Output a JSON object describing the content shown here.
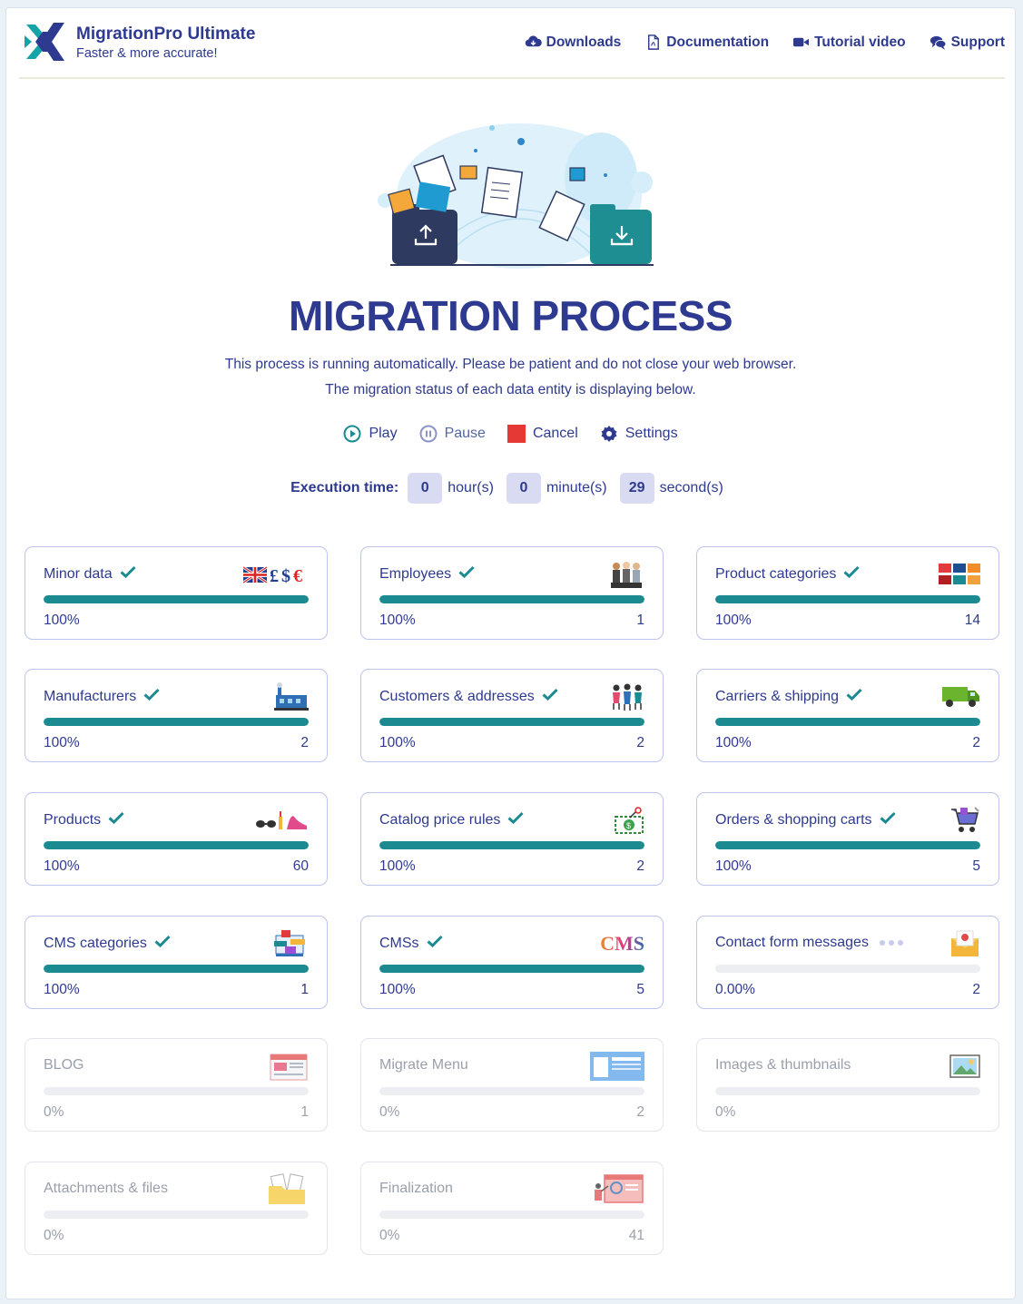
{
  "header": {
    "brand_title": "MigrationPro Ultimate",
    "brand_subtitle": "Faster & more accurate!",
    "nav": [
      {
        "label": "Downloads",
        "icon": "cloud-download-icon"
      },
      {
        "label": "Documentation",
        "icon": "pdf-document-icon"
      },
      {
        "label": "Tutorial video",
        "icon": "video-camera-icon"
      },
      {
        "label": "Support",
        "icon": "chat-bubbles-icon"
      }
    ]
  },
  "main": {
    "title": "MIGRATION PROCESS",
    "description_line1": "This process is running automatically. Please be patient and do not close your web browser.",
    "description_line2": "The migration status of each data entity is displaying below.",
    "controls": {
      "play": "Play",
      "pause": "Pause",
      "cancel": "Cancel",
      "settings": "Settings"
    },
    "execution": {
      "label": "Execution time:",
      "hours": "0",
      "hours_unit": "hour(s)",
      "minutes": "0",
      "minutes_unit": "minute(s)",
      "seconds": "29",
      "seconds_unit": "second(s)"
    }
  },
  "colors": {
    "brand": "#2e3a8f",
    "progress": "#1b8a91",
    "cancel": "#e53935",
    "card_border": "#bcc3ec"
  },
  "entities": [
    {
      "name": "Minor data",
      "status": "done",
      "progress": 1,
      "percent": "100%",
      "count": "",
      "icon": "currency-flag-icon"
    },
    {
      "name": "Employees",
      "status": "done",
      "progress": 1,
      "percent": "100%",
      "count": "1",
      "icon": "employees-icon"
    },
    {
      "name": "Product categories",
      "status": "done",
      "progress": 1,
      "percent": "100%",
      "count": "14",
      "icon": "category-grid-icon"
    },
    {
      "name": "Manufacturers",
      "status": "done",
      "progress": 1,
      "percent": "100%",
      "count": "2",
      "icon": "factory-icon"
    },
    {
      "name": "Customers & addresses",
      "status": "done",
      "progress": 1,
      "percent": "100%",
      "count": "2",
      "icon": "customers-icon"
    },
    {
      "name": "Carriers & shipping",
      "status": "done",
      "progress": 1,
      "percent": "100%",
      "count": "2",
      "icon": "delivery-truck-icon"
    },
    {
      "name": "Products",
      "status": "done",
      "progress": 1,
      "percent": "100%",
      "count": "60",
      "icon": "products-icon"
    },
    {
      "name": "Catalog price rules",
      "status": "done",
      "progress": 1,
      "percent": "100%",
      "count": "2",
      "icon": "price-tag-icon"
    },
    {
      "name": "Orders & shopping carts",
      "status": "done",
      "progress": 1,
      "percent": "100%",
      "count": "5",
      "icon": "shopping-cart-icon"
    },
    {
      "name": "CMS categories",
      "status": "done",
      "progress": 1,
      "percent": "100%",
      "count": "1",
      "icon": "cms-category-icon"
    },
    {
      "name": "CMSs",
      "status": "done",
      "progress": 1,
      "percent": "100%",
      "count": "5",
      "icon": "cms-text-icon",
      "icon_text": "CMS"
    },
    {
      "name": "Contact form messages",
      "status": "running",
      "progress": 0,
      "percent": "0.00%",
      "count": "2",
      "icon": "envelope-icon"
    },
    {
      "name": "BLOG",
      "status": "pending",
      "progress": 0,
      "percent": "0%",
      "count": "1",
      "icon": "blog-page-icon"
    },
    {
      "name": "Migrate Menu",
      "status": "pending",
      "progress": 0,
      "percent": "0%",
      "count": "2",
      "icon": "menu-layout-icon"
    },
    {
      "name": "Images & thumbnails",
      "status": "pending",
      "progress": 0,
      "percent": "0%",
      "count": "",
      "icon": "image-icon"
    },
    {
      "name": "Attachments & files",
      "status": "pending",
      "progress": 0,
      "percent": "0%",
      "count": "",
      "icon": "folder-files-icon"
    },
    {
      "name": "Finalization",
      "status": "pending",
      "progress": 0,
      "percent": "0%",
      "count": "41",
      "icon": "presentation-icon"
    }
  ]
}
